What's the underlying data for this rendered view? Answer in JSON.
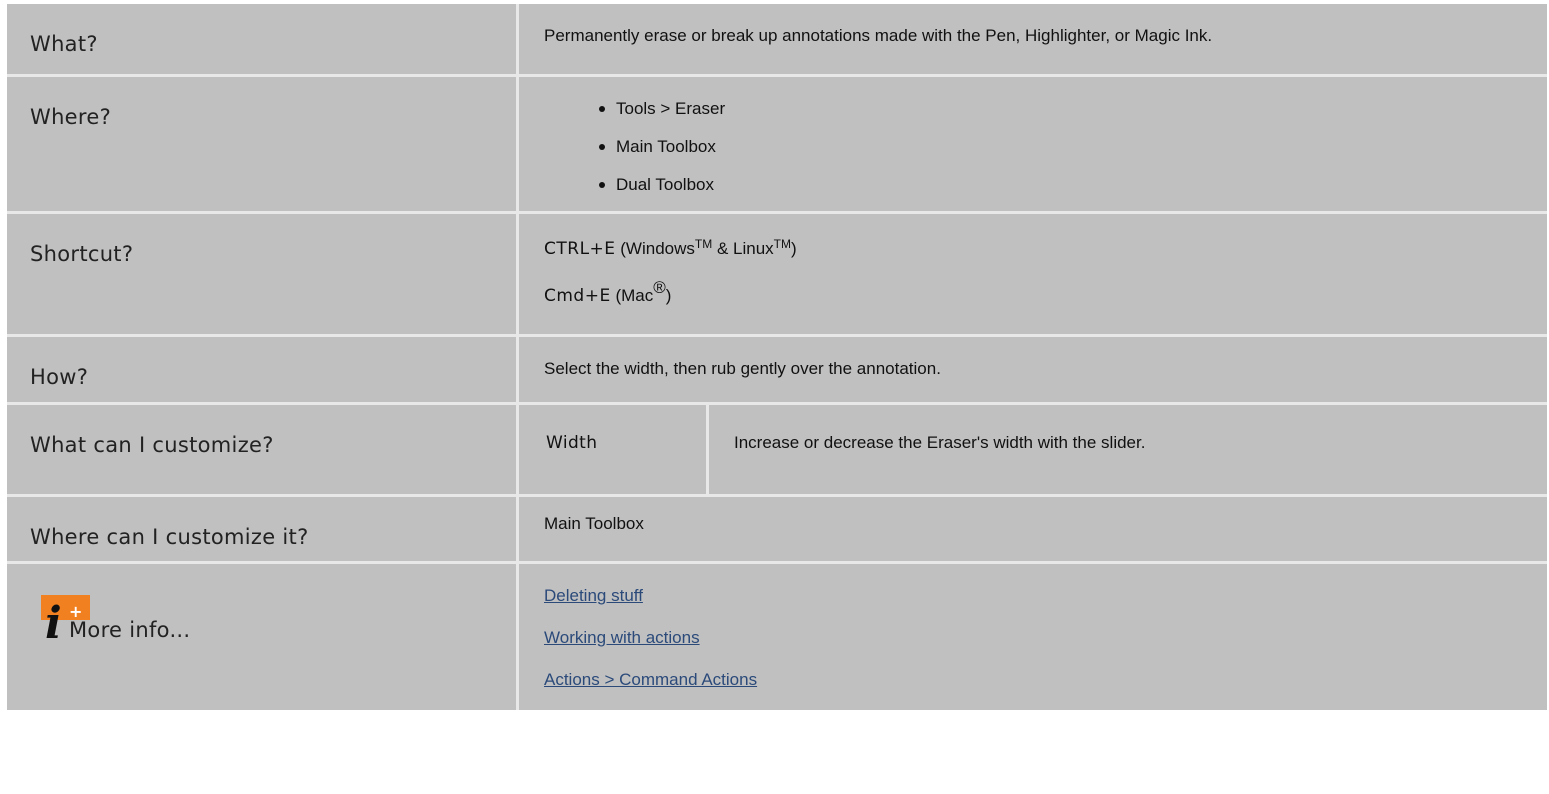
{
  "rows": {
    "what": {
      "label": "What?",
      "text": "Permanently erase or break up annotations made with the Pen, Highlighter, or Magic Ink."
    },
    "where": {
      "label": "Where?",
      "items": [
        "Tools > Eraser",
        "Main Toolbox",
        "Dual Toolbox"
      ]
    },
    "shortcut": {
      "label": "Shortcut?",
      "windows_key": "CTRL+E",
      "windows_open": " (Windows",
      "tm": "TM",
      "windows_mid": " & Linux",
      "windows_close": ")",
      "mac_key": "Cmd+E",
      "mac_open": " (Mac",
      "reg": "®",
      "mac_close": ")"
    },
    "how": {
      "label": "How?",
      "text": "Select the width, then rub gently over the annotation."
    },
    "customize": {
      "label": "What can I customize?",
      "key": "Width",
      "value": "Increase or decrease the Eraser's width with the slider."
    },
    "customize_where": {
      "label": "Where can I customize it?",
      "text": "Main Toolbox"
    },
    "more_info": {
      "label": "More info...",
      "icon_letter": "i",
      "icon_plus": "+",
      "icon_color": "#f08020",
      "links": [
        "Deleting stuff",
        "Working with actions",
        "Actions > Command Actions"
      ]
    }
  },
  "colors": {
    "cell_bg": "#c0c0c0",
    "separator": "#e8e8e8",
    "link": "#2b4a7a"
  }
}
